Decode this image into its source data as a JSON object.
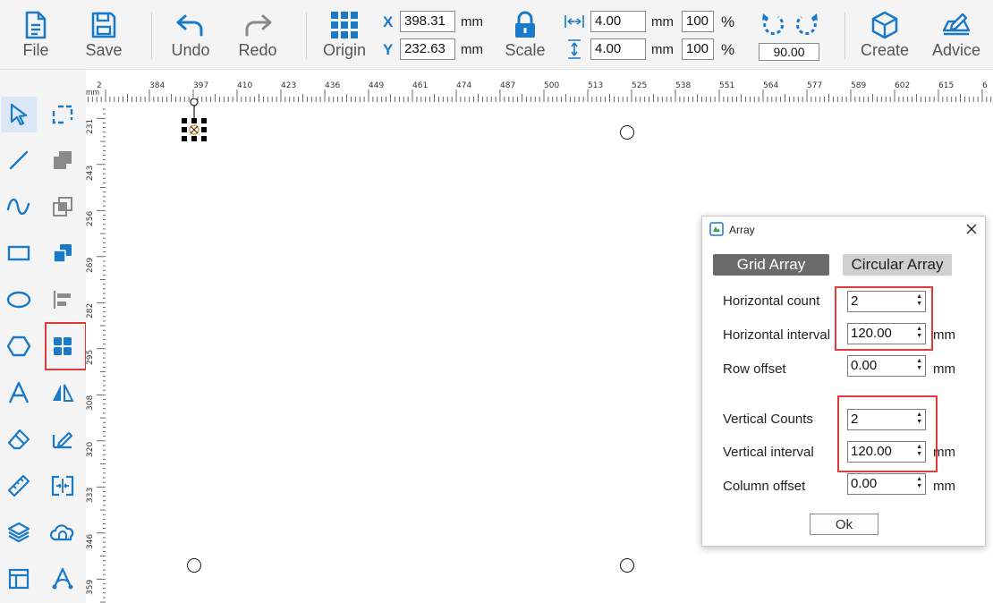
{
  "toolbar": {
    "file": "File",
    "save": "Save",
    "undo": "Undo",
    "redo": "Redo",
    "origin": "Origin",
    "scale": "Scale",
    "create": "Create",
    "advice": "Advice",
    "x_label": "X",
    "y_label": "Y",
    "x_value": "398.31",
    "y_value": "232.63",
    "unit_mm": "mm",
    "width_value": "4.00",
    "height_value": "4.00",
    "width_percent": "100",
    "height_percent": "100",
    "percent_sign": "%",
    "rotation_value": "90.00"
  },
  "ruler": {
    "unit": "mm",
    "h_labels": [
      "2",
      "384",
      "397",
      "410",
      "423",
      "436",
      "449",
      "461",
      "474",
      "487",
      "500",
      "513",
      "525",
      "538",
      "551",
      "564",
      "577",
      "589",
      "602",
      "615",
      "6"
    ],
    "v_labels": [
      "231",
      "243",
      "256",
      "269",
      "282",
      "295",
      "308",
      "320",
      "333",
      "346",
      "359"
    ]
  },
  "dialog": {
    "title": "Array",
    "tab_grid": "Grid Array",
    "tab_circular": "Circular Array",
    "horizontal_count_label": "Horizontal count",
    "horizontal_count": "2",
    "horizontal_interval_label": "Horizontal interval",
    "horizontal_interval": "120.00",
    "row_offset_label": "Row offset",
    "row_offset": "0.00",
    "vertical_counts_label": "Vertical Counts",
    "vertical_counts": "2",
    "vertical_interval_label": "Vertical interval",
    "vertical_interval": "120.00",
    "column_offset_label": "Column offset",
    "column_offset": "0.00",
    "unit": "mm",
    "ok": "Ok"
  },
  "colors": {
    "accent": "#1a7ac8",
    "highlight": "#e03a3a",
    "tab_active_bg": "#6b6b6b",
    "tab_inactive_bg": "#cfcfcf"
  }
}
